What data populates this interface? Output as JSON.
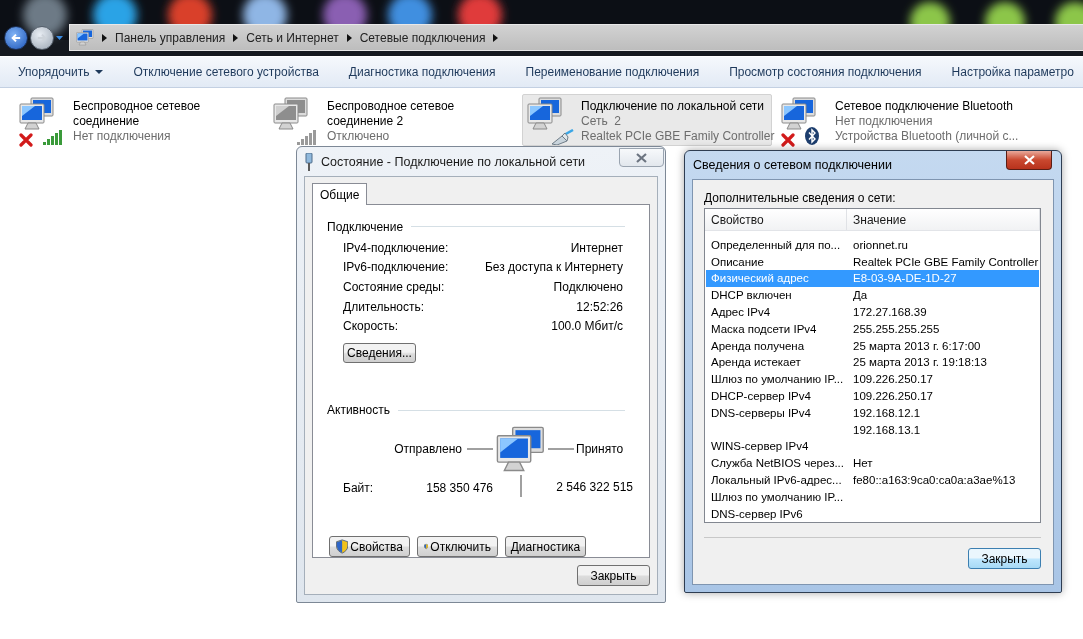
{
  "address_bar": {
    "breadcrumbs": [
      "Панель управления",
      "Сеть и Интернет",
      "Сетевые подключения"
    ]
  },
  "toolbar": {
    "items": [
      {
        "label": "Упорядочить",
        "kind": "menu"
      },
      {
        "label": "Отключение сетевого устройства",
        "kind": "button"
      },
      {
        "label": "Диагностика подключения",
        "kind": "button"
      },
      {
        "label": "Переименование подключения",
        "kind": "button"
      },
      {
        "label": "Просмотр состояния подключения",
        "kind": "button"
      },
      {
        "label": "Настройка параметро",
        "kind": "button"
      }
    ]
  },
  "connections": [
    {
      "name": "Беспроводное сетевое соединение",
      "status": "Нет подключения",
      "kind": "wireless",
      "error": true,
      "disabled": false,
      "selected": false
    },
    {
      "name": "Беспроводное сетевое соединение 2",
      "status": "Отключено",
      "kind": "wireless",
      "error": false,
      "disabled": true,
      "selected": false
    },
    {
      "name": "Подключение по локальной сети",
      "status": "Сеть  2",
      "device": "Realtek PCIe GBE Family Controller",
      "kind": "wired",
      "error": false,
      "disabled": false,
      "selected": true
    },
    {
      "name": "Сетевое подключение Bluetooth",
      "status": "Нет подключения",
      "device": "Устройства Bluetooth (личной с...",
      "kind": "bluetooth",
      "error": true,
      "disabled": false,
      "selected": false
    }
  ],
  "status_dialog": {
    "title": "Состояние - Подключение по локальной сети",
    "tabs": [
      {
        "label": "Общие",
        "selected": true
      }
    ],
    "connection": {
      "title": "Подключение",
      "rows": [
        {
          "label": "IPv4-подключение:",
          "value": "Интернет"
        },
        {
          "label": "IPv6-подключение:",
          "value": "Без доступа к Интернету"
        },
        {
          "label": "Состояние среды:",
          "value": "Подключено"
        },
        {
          "label": "Длительность:",
          "value": "12:52:26"
        },
        {
          "label": "Скорость:",
          "value": "100.0 Мбит/с"
        }
      ],
      "details_button": "Сведения..."
    },
    "activity": {
      "title": "Активность",
      "sent_label": "Отправлено",
      "received_label": "Принято",
      "bytes_label": "Байт:",
      "sent": "158 350 476",
      "received": "2 546 322 515"
    },
    "buttons": [
      {
        "label": "Свойства",
        "shield": true
      },
      {
        "label": "Отключить",
        "shield": true
      },
      {
        "label": "Диагностика",
        "shield": false
      }
    ],
    "close_button": "Закрыть"
  },
  "details_dialog": {
    "title": "Сведения о сетевом подключении",
    "caption": "Дополнительные сведения о сети:",
    "columns": [
      "Свойство",
      "Значение"
    ],
    "rows": [
      {
        "property": "Определенный для по...",
        "value": "orionnet.ru",
        "selected": false
      },
      {
        "property": "Описание",
        "value": "Realtek PCIe GBE Family Controller",
        "selected": false
      },
      {
        "property": "Физический адрес",
        "value": "E8-03-9A-DE-1D-27",
        "selected": true
      },
      {
        "property": "DHCP включен",
        "value": "Да",
        "selected": false
      },
      {
        "property": "Адрес IPv4",
        "value": "172.27.168.39",
        "selected": false
      },
      {
        "property": "Маска подсети IPv4",
        "value": "255.255.255.255",
        "selected": false
      },
      {
        "property": "Аренда получена",
        "value": "25 марта 2013 г. 6:17:00",
        "selected": false
      },
      {
        "property": "Аренда истекает",
        "value": "25 марта 2013 г. 19:18:13",
        "selected": false
      },
      {
        "property": "Шлюз по умолчанию IP...",
        "value": "109.226.250.17",
        "selected": false
      },
      {
        "property": "DHCP-сервер IPv4",
        "value": "109.226.250.17",
        "selected": false
      },
      {
        "property": "DNS-серверы IPv4",
        "value": "192.168.12.1",
        "selected": false
      },
      {
        "value": "192.168.13.1",
        "selected": false
      },
      {
        "property": "WINS-сервер IPv4",
        "selected": false
      },
      {
        "property": "Служба NetBIOS через...",
        "value": "Нет",
        "selected": false
      },
      {
        "property": "Локальный IPv6-адрес...",
        "value": "fe80::a163:9ca0:ca0a:a3ae%13",
        "selected": false
      },
      {
        "property": "Шлюз по умолчанию IP...",
        "selected": false
      },
      {
        "property": "DNS-сервер IPv6",
        "selected": false
      }
    ],
    "close_button": "Закрыть"
  }
}
